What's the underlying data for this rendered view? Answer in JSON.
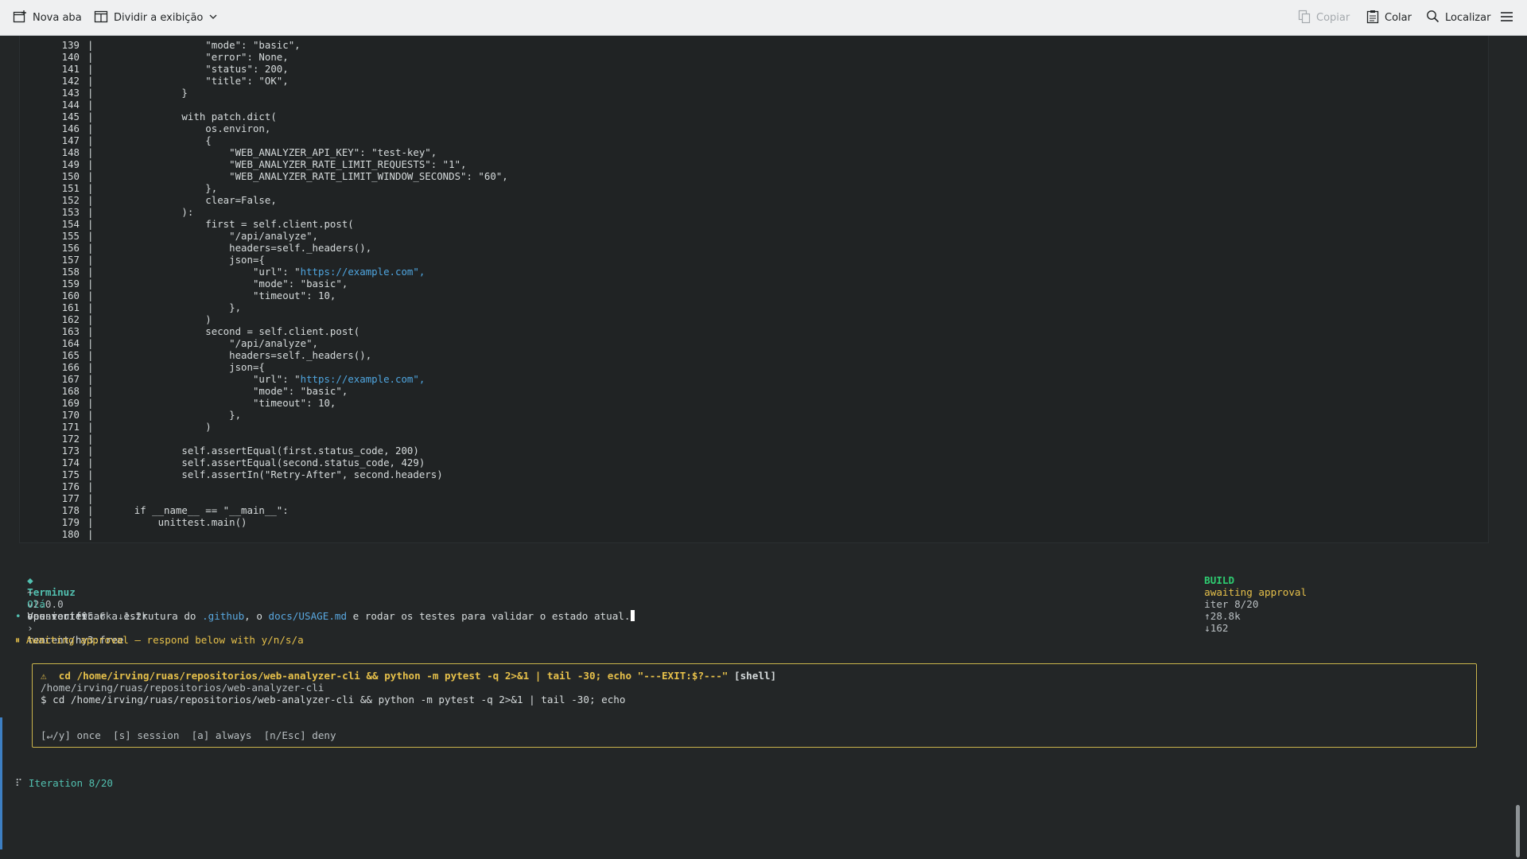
{
  "toolbar": {
    "new_tab": "Nova aba",
    "split_view": "Dividir a exibição",
    "copy": "Copiar",
    "paste": "Colar",
    "find": "Localizar",
    "icons": [
      "new-tab-icon",
      "split-view-icon",
      "chevron-down-icon",
      "copy-icon",
      "paste-icon",
      "search-icon",
      "hamburger-menu-icon"
    ]
  },
  "code": {
    "lines": [
      {
        "n": "139",
        "t": "                  \"mode\": \"basic\","
      },
      {
        "n": "140",
        "t": "                  \"error\": None,"
      },
      {
        "n": "141",
        "t": "                  \"status\": 200,"
      },
      {
        "n": "142",
        "t": "                  \"title\": \"OK\","
      },
      {
        "n": "143",
        "t": "              }"
      },
      {
        "n": "144",
        "t": ""
      },
      {
        "n": "145",
        "t": "              with patch.dict("
      },
      {
        "n": "146",
        "t": "                  os.environ,"
      },
      {
        "n": "147",
        "t": "                  {"
      },
      {
        "n": "148",
        "t": "                      \"WEB_ANALYZER_API_KEY\": \"test-key\","
      },
      {
        "n": "149",
        "t": "                      \"WEB_ANALYZER_RATE_LIMIT_REQUESTS\": \"1\","
      },
      {
        "n": "150",
        "t": "                      \"WEB_ANALYZER_RATE_LIMIT_WINDOW_SECONDS\": \"60\","
      },
      {
        "n": "151",
        "t": "                  },"
      },
      {
        "n": "152",
        "t": "                  clear=False,"
      },
      {
        "n": "153",
        "t": "              ):"
      },
      {
        "n": "154",
        "t": "                  first = self.client.post("
      },
      {
        "n": "155",
        "t": "                      \"/api/analyze\","
      },
      {
        "n": "156",
        "t": "                      headers=self._headers(),"
      },
      {
        "n": "157",
        "t": "                      json={"
      },
      {
        "n": "158",
        "t": "                          \"url\": \"",
        "url": "https://example.com",
        "tail": "\","
      },
      {
        "n": "159",
        "t": "                          \"mode\": \"basic\","
      },
      {
        "n": "160",
        "t": "                          \"timeout\": 10,"
      },
      {
        "n": "161",
        "t": "                      },"
      },
      {
        "n": "162",
        "t": "                  )"
      },
      {
        "n": "163",
        "t": "                  second = self.client.post("
      },
      {
        "n": "164",
        "t": "                      \"/api/analyze\","
      },
      {
        "n": "165",
        "t": "                      headers=self._headers(),"
      },
      {
        "n": "166",
        "t": "                      json={"
      },
      {
        "n": "167",
        "t": "                          \"url\": \"",
        "url": "https://example.com",
        "tail": "\","
      },
      {
        "n": "168",
        "t": "                          \"mode\": \"basic\","
      },
      {
        "n": "169",
        "t": "                          \"timeout\": 10,"
      },
      {
        "n": "170",
        "t": "                      },"
      },
      {
        "n": "171",
        "t": "                  )"
      },
      {
        "n": "172",
        "t": ""
      },
      {
        "n": "173",
        "t": "              self.assertEqual(first.status_code, 200)"
      },
      {
        "n": "174",
        "t": "              self.assertEqual(second.status_code, 429)"
      },
      {
        "n": "175",
        "t": "              self.assertIn(\"Retry-After\", second.headers)"
      },
      {
        "n": "176",
        "t": ""
      },
      {
        "n": "177",
        "t": ""
      },
      {
        "n": "178",
        "t": "      if __name__ == \"__main__\":"
      },
      {
        "n": "179",
        "t": "          unittest.main()"
      },
      {
        "n": "180",
        "t": ""
      }
    ]
  },
  "status": {
    "diamond": "◆",
    "app": "Terminuz",
    "version": "v2.0.0",
    "provider": "openrouter",
    "arrow": "›",
    "model": "tencent/hy3:free",
    "build": "BUILD",
    "build_state": "awaiting approval",
    "iter": "iter 8/20",
    "tokens_up": "↑28.8k",
    "tokens_down": "↓162",
    "tilde": "~",
    "greeting": "Olá",
    "session": "session ↑95.6k ↓1.2k"
  },
  "message": {
    "bullet": "•",
    "p1": "Vou verificar a estrutura do ",
    "link1": ".github",
    "p2": ", o ",
    "link2": "docs/USAGE.md",
    "p3": " e rodar os testes para validar o estado atual."
  },
  "awaiting": {
    "icon": "⏸",
    "text": "Awaiting approval — respond below with y/n/s/a"
  },
  "approval": {
    "warn_icon": "⚠",
    "command": "cd /home/irving/ruas/repositorios/web-analyzer-cli && python -m pytest -q 2>&1 | tail -30; echo \"---EXIT:$?---\"",
    "tag": "[shell]",
    "cwd": "/home/irving/ruas/repositorios/web-analyzer-cli",
    "prompt": "$ cd /home/irving/ruas/repositorios/web-analyzer-cli && python -m pytest -q 2>&1 | tail -30; echo",
    "options": {
      "once": "[↵/y] once",
      "session": "[s] session",
      "always": "[a] always",
      "deny": "[n/Esc] deny"
    }
  },
  "iteration": {
    "spinner": "⠏",
    "text": "Iteration 8/20"
  },
  "colors": {
    "background": "#232627",
    "accent_teal": "#52c0b0",
    "build_green": "#2ecc71",
    "warning_yellow": "#e6c04a",
    "link_blue": "#4fa6e0"
  }
}
